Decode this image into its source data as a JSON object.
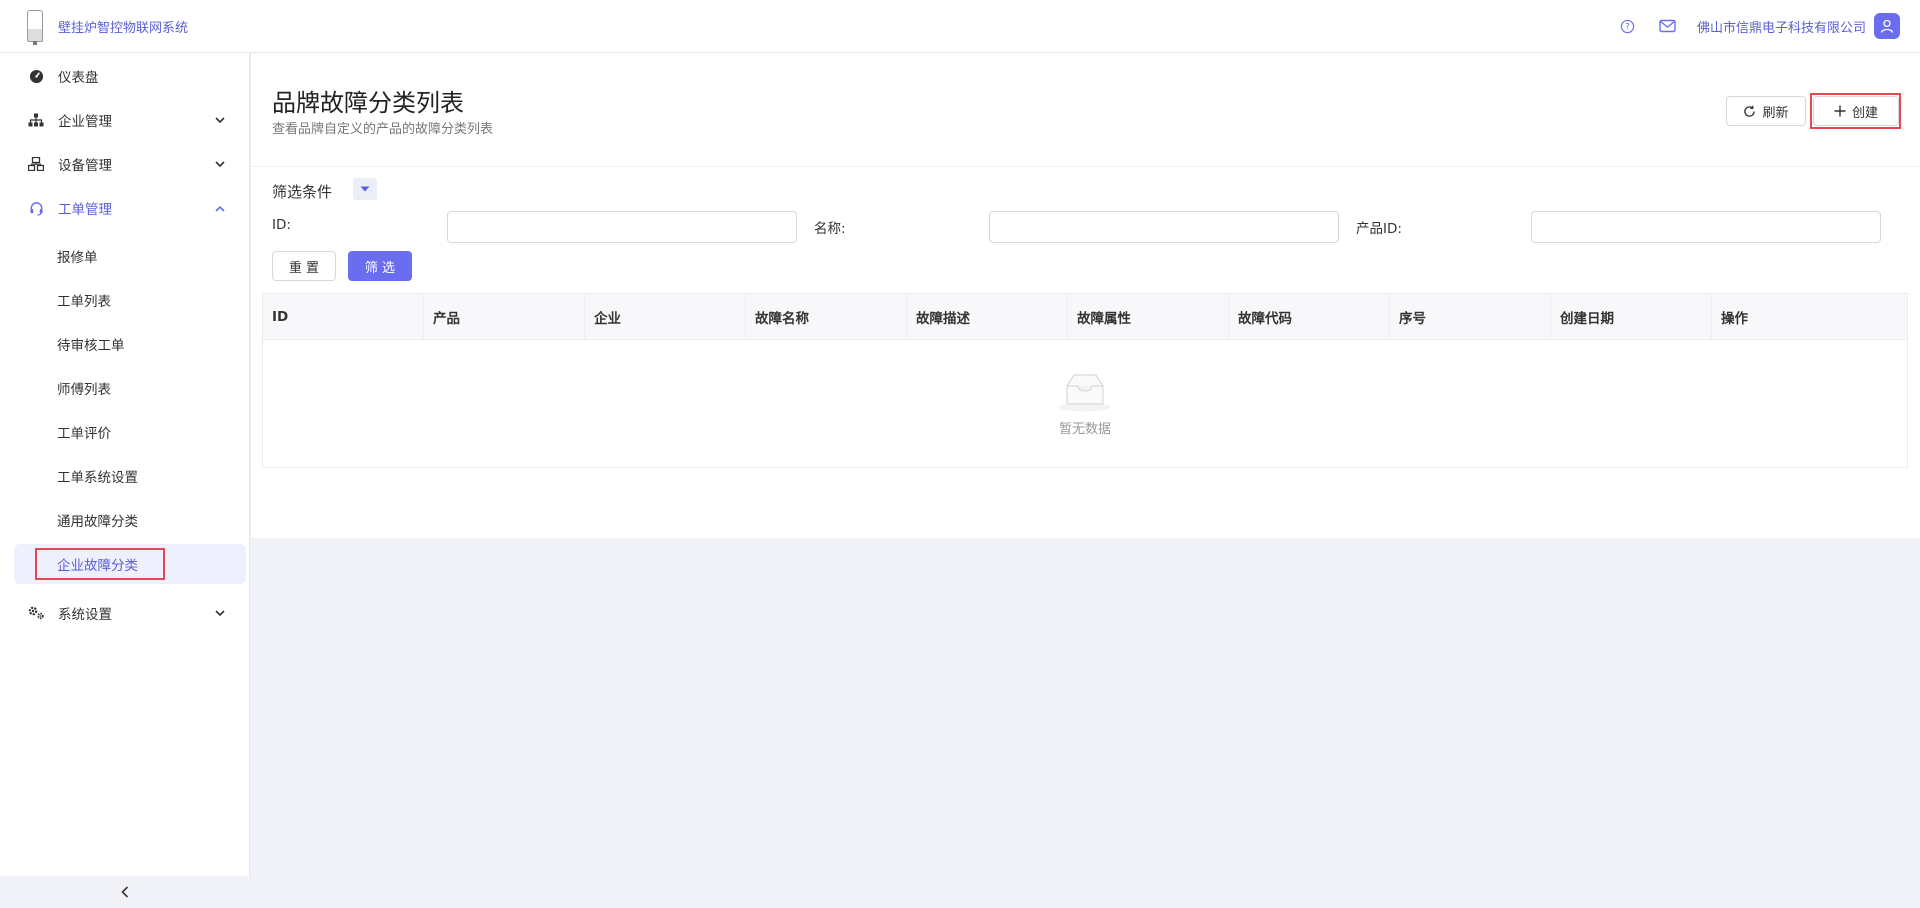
{
  "app": {
    "title": "壁挂炉智控物联网系统",
    "company": "佛山市信鼎电子科技有限公司",
    "accent": "#6b6df0"
  },
  "header": {
    "icons": [
      "help-icon",
      "mail-icon",
      "user-icon"
    ]
  },
  "sidebar": {
    "items": [
      {
        "label": "仪表盘",
        "icon": "dashboard-icon",
        "expandable": false
      },
      {
        "label": "企业管理",
        "icon": "org-chart-icon",
        "expandable": true,
        "expanded": false
      },
      {
        "label": "设备管理",
        "icon": "devices-icon",
        "expandable": true,
        "expanded": false
      },
      {
        "label": "工单管理",
        "icon": "headset-icon",
        "expandable": true,
        "expanded": true
      },
      {
        "label": "系统设置",
        "icon": "settings-icon",
        "expandable": true,
        "expanded": false
      }
    ],
    "sub_items": [
      "报修单",
      "工单列表",
      "待审核工单",
      "师傅列表",
      "工单评价",
      "工单系统设置",
      "通用故障分类",
      "企业故障分类"
    ],
    "selected_sub": "企业故障分类"
  },
  "page": {
    "title": "品牌故障分类列表",
    "subtitle": "查看品牌自定义的产品的故障分类列表",
    "refresh_label": "刷新",
    "create_label": "创建"
  },
  "filter": {
    "title": "筛选条件",
    "fields": [
      {
        "label": "ID:",
        "value": ""
      },
      {
        "label": "名称:",
        "value": ""
      },
      {
        "label": "产品ID:",
        "value": ""
      }
    ],
    "reset_label": "重 置",
    "submit_label": "筛 选"
  },
  "table": {
    "columns": [
      "ID",
      "产品",
      "企业",
      "故障名称",
      "故障描述",
      "故障属性",
      "故障代码",
      "序号",
      "创建日期",
      "操作"
    ],
    "rows": [],
    "empty_text": "暂无数据"
  }
}
